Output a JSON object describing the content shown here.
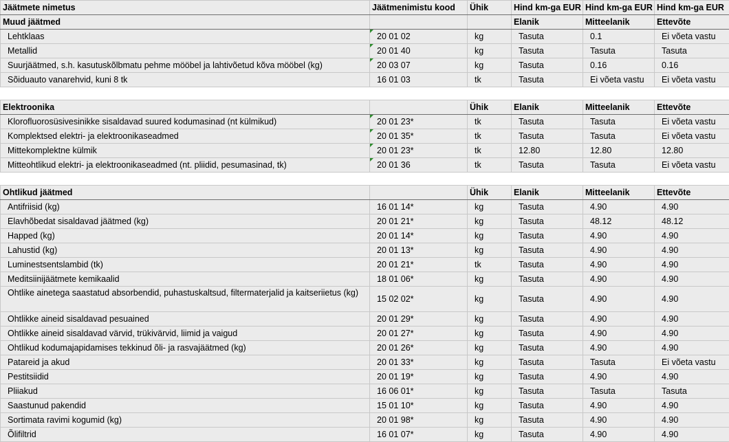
{
  "header": {
    "name": "Jäätmete nimetus",
    "code": "Jäätmenimistu kood",
    "unit": "Ühik",
    "price1": "Hind km-ga EUR",
    "price2": "Hind km-ga EUR",
    "price3": "Hind km-ga EUR"
  },
  "sections": [
    {
      "title": "Muud jäätmed",
      "code": "",
      "unit": "",
      "col1": "Elanik",
      "col2": "Mitteelanik",
      "col3": "Ettevõte",
      "rows": [
        {
          "name": "Lehtklaas",
          "code": "20 01 02",
          "unit": "kg",
          "resident": "Tasuta",
          "nonresident": "0.1",
          "company": "Ei võeta vastu"
        },
        {
          "name": "Metallid",
          "code": "20 01 40",
          "unit": "kg",
          "resident": "Tasuta",
          "nonresident": "Tasuta",
          "company": "Tasuta"
        },
        {
          "name": "Suurjäätmed, s.h. kasutuskõlbmatu pehme mööbel ja lahtivõetud kõva mööbel (kg)",
          "code": "20 03 07",
          "unit": "kg",
          "resident": "Tasuta",
          "nonresident": "0.16",
          "company": "0.16"
        },
        {
          "name": "Sõiduauto vanarehvid, kuni 8 tk",
          "code": "16 01 03",
          "unit": "tk",
          "resident": "Tasuta",
          "nonresident": "Ei võeta vastu",
          "company": "Ei võeta vastu"
        }
      ]
    },
    {
      "title": "Elektroonika",
      "code": "",
      "unit": "Ühik",
      "col1": "Elanik",
      "col2": "Mitteelanik",
      "col3": "Ettevõte",
      "rows": [
        {
          "name": "Klorofluorosüsivesinikke sisaldavad suured kodumasinad (nt külmikud)",
          "code": "20 01 23*",
          "unit": "tk",
          "resident": "Tasuta",
          "nonresident": "Tasuta",
          "company": "Ei võeta vastu"
        },
        {
          "name": "Komplektsed elektri- ja elektroonikaseadmed",
          "code": "20 01 35*",
          "unit": "tk",
          "resident": "Tasuta",
          "nonresident": "Tasuta",
          "company": "Ei võeta vastu"
        },
        {
          "name": "Mittekomplektne külmik",
          "code": "20 01 23*",
          "unit": "tk",
          "resident": "12.80",
          "nonresident": "12.80",
          "company": "12.80"
        },
        {
          "name": "Mitteohtlikud elektri- ja elektroonikaseadmed (nt. pliidid, pesumasinad, tk)",
          "code": "20 01 36",
          "unit": "tk",
          "resident": "Tasuta",
          "nonresident": "Tasuta",
          "company": "Ei võeta vastu"
        }
      ]
    },
    {
      "title": "Ohtlikud jäätmed",
      "code": "",
      "unit": "Ühik",
      "col1": "Elanik",
      "col2": "Mitteelanik",
      "col3": "Ettevõte",
      "rows": [
        {
          "name": "Antifriisid (kg)",
          "code": "16 01 14*",
          "unit": "kg",
          "resident": "Tasuta",
          "nonresident": "4.90",
          "company": "4.90"
        },
        {
          "name": "Elavhõbedat sisaldavad jäätmed (kg)",
          "code": "20 01 21*",
          "unit": "kg",
          "resident": "Tasuta",
          "nonresident": "48.12",
          "company": "48.12"
        },
        {
          "name": "Happed (kg)",
          "code": "20 01 14*",
          "unit": "kg",
          "resident": "Tasuta",
          "nonresident": "4.90",
          "company": "4.90"
        },
        {
          "name": "Lahustid (kg)",
          "code": "20 01 13*",
          "unit": "kg",
          "resident": "Tasuta",
          "nonresident": "4.90",
          "company": "4.90"
        },
        {
          "name": "Luminestsentslambid (tk)",
          "code": "20 01 21*",
          "unit": "tk",
          "resident": "Tasuta",
          "nonresident": "4.90",
          "company": "4.90"
        },
        {
          "name": "Meditsiinijäätmete kemikaalid",
          "code": "18 01 06*",
          "unit": "kg",
          "resident": "Tasuta",
          "nonresident": "4.90",
          "company": "4.90"
        },
        {
          "name": "Ohtlike ainetega saastatud absorbendid, puhastuskaltsud, filtermaterjalid ja kaitseriietus (kg)",
          "code": "15 02 02*",
          "unit": "kg",
          "resident": "Tasuta",
          "nonresident": "4.90",
          "company": "4.90",
          "tall": true
        },
        {
          "name": "Ohtlikke aineid sisaldavad pesuained",
          "code": "20 01 29*",
          "unit": "kg",
          "resident": "Tasuta",
          "nonresident": "4.90",
          "company": "4.90"
        },
        {
          "name": "Ohtlikke aineid sisaldavad värvid, trükivärvid, liimid ja vaigud",
          "code": "20 01 27*",
          "unit": "kg",
          "resident": "Tasuta",
          "nonresident": "4.90",
          "company": "4.90"
        },
        {
          "name": "Ohtlikud kodumajapidamises tekkinud õli- ja rasvajäätmed (kg)",
          "code": "20 01 26*",
          "unit": "kg",
          "resident": "Tasuta",
          "nonresident": "4.90",
          "company": "4.90"
        },
        {
          "name": "Patareid ja akud",
          "code": "20 01 33*",
          "unit": "kg",
          "resident": "Tasuta",
          "nonresident": "Tasuta",
          "company": "Ei võeta vastu"
        },
        {
          "name": "Pestitsiidid",
          "code": "20 01 19*",
          "unit": "kg",
          "resident": "Tasuta",
          "nonresident": "4.90",
          "company": "4.90"
        },
        {
          "name": "Pliiakud",
          "code": "16 06 01*",
          "unit": "kg",
          "resident": "Tasuta",
          "nonresident": "Tasuta",
          "company": "Tasuta"
        },
        {
          "name": "Saastunud pakendid",
          "code": "15 01 10*",
          "unit": "kg",
          "resident": "Tasuta",
          "nonresident": "4.90",
          "company": "4.90"
        },
        {
          "name": "Sortimata ravimi kogumid (kg)",
          "code": "20 01 98*",
          "unit": "kg",
          "resident": "Tasuta",
          "nonresident": "4.90",
          "company": "4.90"
        },
        {
          "name": "Õlifiltrid",
          "code": "16 01 07*",
          "unit": "kg",
          "resident": "Tasuta",
          "nonresident": "4.90",
          "company": "4.90"
        }
      ]
    }
  ]
}
